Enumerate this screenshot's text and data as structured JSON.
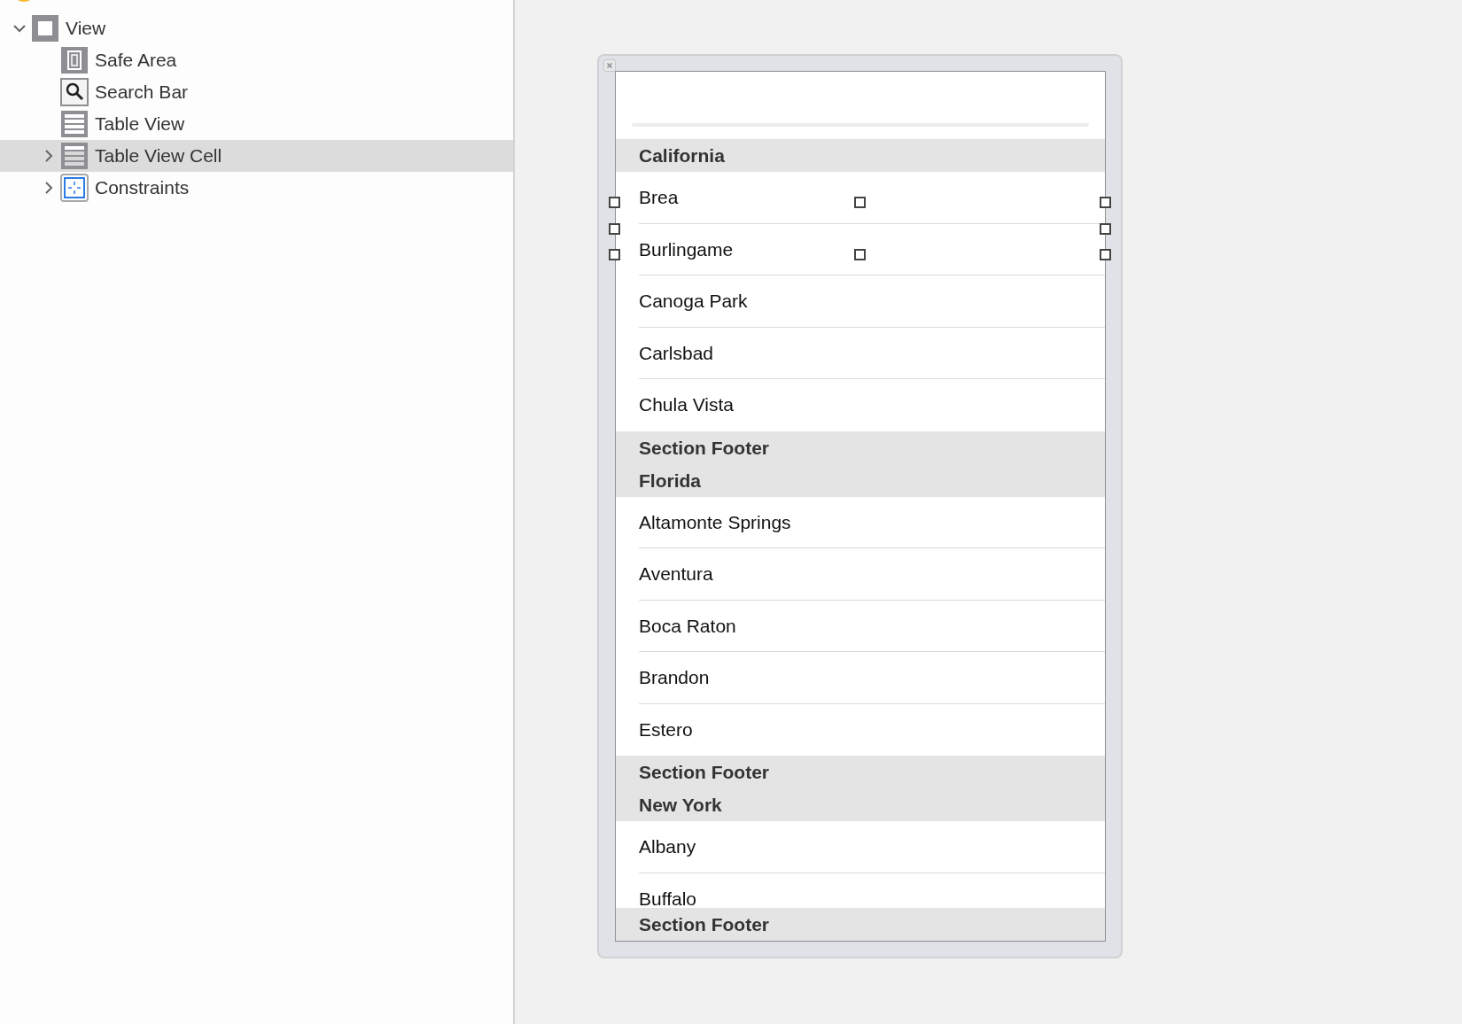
{
  "outline": [
    {
      "label": "View",
      "kind": "view",
      "expanded": true,
      "selected": false,
      "children": [
        {
          "label": "Safe Area",
          "kind": "safe-area",
          "selected": false
        },
        {
          "label": "Search Bar",
          "kind": "search",
          "selected": false
        },
        {
          "label": "Table View",
          "kind": "table",
          "selected": false
        },
        {
          "label": "Table View Cell",
          "kind": "cell",
          "expanded": false,
          "selected": true
        },
        {
          "label": "Constraints",
          "kind": "constraints",
          "expanded": false,
          "selected": false
        }
      ]
    }
  ],
  "table": {
    "sections": [
      {
        "header": "California",
        "rows": [
          "Brea",
          "Burlingame",
          "Canoga Park",
          "Carlsbad",
          "Chula Vista"
        ],
        "footer": "Section Footer"
      },
      {
        "header": "Florida",
        "rows": [
          "Altamonte Springs",
          "Aventura",
          "Boca Raton",
          "Brandon",
          "Estero"
        ],
        "footer": "Section Footer"
      },
      {
        "header": "New York",
        "rows": [
          "Albany",
          "Buffalo"
        ],
        "footer": "Section Footer"
      }
    ]
  }
}
